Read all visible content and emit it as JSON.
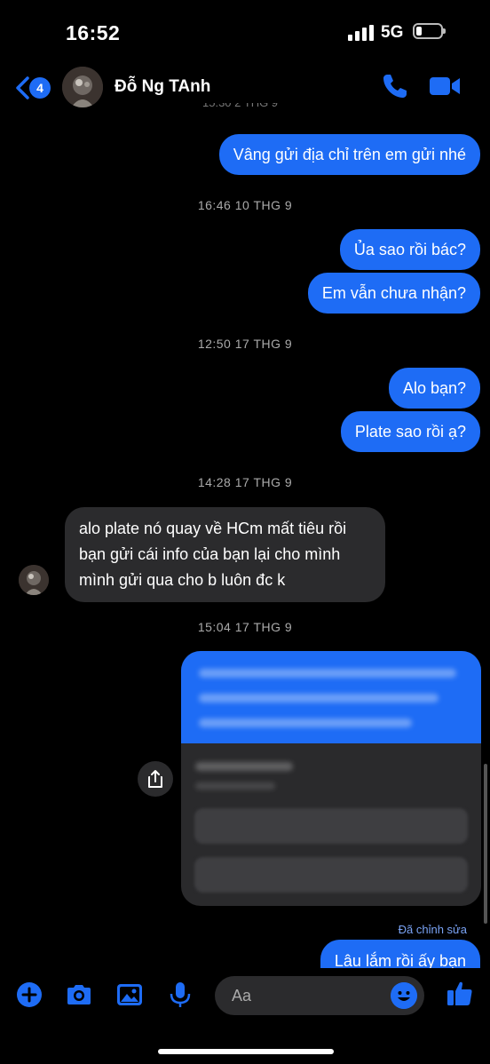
{
  "status_bar": {
    "time": "16:52",
    "network": "5G"
  },
  "header": {
    "unread_count": "4",
    "contact_name": "Đỗ Ng TAnh"
  },
  "messages": [
    {
      "type": "outgoing",
      "text": "Vâng gửi địa chỉ trên em gửi nhé"
    },
    {
      "type": "timestamp",
      "text": "16:46 10 THG 9"
    },
    {
      "type": "outgoing",
      "text": "Ủa sao rồi bác?"
    },
    {
      "type": "outgoing",
      "text": "Em vẫn chưa nhận?"
    },
    {
      "type": "timestamp",
      "text": "12:50 17 THG 9"
    },
    {
      "type": "outgoing",
      "text": "Alo bạn?"
    },
    {
      "type": "outgoing",
      "text": "Plate sao rồi ạ?"
    },
    {
      "type": "timestamp",
      "text": "14:28 17 THG 9"
    },
    {
      "type": "incoming",
      "lines": [
        "alo plate nó quay về HCm mất tiêu rồi",
        "bạn gửi cái info của bạn lại cho mình",
        "mình gửi qua cho b luôn đc k"
      ]
    },
    {
      "type": "timestamp",
      "text": "15:04 17 THG 9"
    },
    {
      "type": "outgoing",
      "text": "Lâu lắm rồi ấy bạn",
      "edited_label": "Đã chỉnh sửa"
    }
  ],
  "composer": {
    "placeholder": "Aa"
  },
  "colors": {
    "accent": "#1e6cf5",
    "incoming_bubble": "#2b2b2d",
    "background": "#000000"
  },
  "icons": [
    "back-chevron-icon",
    "phone-icon",
    "video-camera-icon",
    "share-icon",
    "plus-icon",
    "camera-icon",
    "gallery-icon",
    "microphone-icon",
    "emoji-icon",
    "thumbs-up-icon"
  ]
}
